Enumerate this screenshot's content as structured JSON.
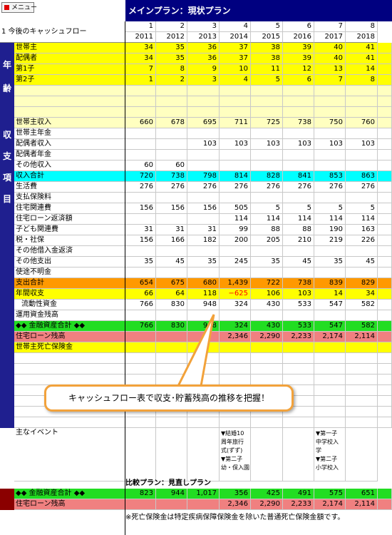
{
  "menu": {
    "label": "メニュー"
  },
  "title": "メインプラン：現状プラン",
  "header": {
    "section_label": "1 今後のキャッシュフロー",
    "indices": [
      "1",
      "2",
      "3",
      "4",
      "5",
      "6",
      "7",
      "8"
    ],
    "years": [
      "2011",
      "2012",
      "2013",
      "2014",
      "2015",
      "2016",
      "2017",
      "2018"
    ]
  },
  "side": {
    "age": [
      "年",
      "齢"
    ],
    "cf": [
      "収",
      "支",
      "項",
      "目"
    ]
  },
  "age_rows": [
    {
      "label": "世帯主",
      "values": [
        "34",
        "35",
        "36",
        "37",
        "38",
        "39",
        "40",
        "41"
      ]
    },
    {
      "label": "配偶者",
      "values": [
        "34",
        "35",
        "36",
        "37",
        "38",
        "39",
        "40",
        "41"
      ]
    },
    {
      "label": "第1子",
      "values": [
        "7",
        "8",
        "9",
        "10",
        "11",
        "12",
        "13",
        "14"
      ]
    },
    {
      "label": "第2子",
      "values": [
        "1",
        "2",
        "3",
        "4",
        "5",
        "6",
        "7",
        "8"
      ]
    }
  ],
  "cf_rows": [
    {
      "label": "世帯主収入",
      "values": [
        "660",
        "678",
        "695",
        "711",
        "725",
        "738",
        "750",
        "760"
      ]
    },
    {
      "label": "世帯主年金",
      "values": [
        "",
        "",
        "",
        "",
        "",
        "",
        "",
        ""
      ]
    },
    {
      "label": "配偶者収入",
      "values": [
        "",
        "",
        "103",
        "103",
        "103",
        "103",
        "103",
        "103"
      ]
    },
    {
      "label": "配偶者年金",
      "values": [
        "",
        "",
        "",
        "",
        "",
        "",
        "",
        ""
      ]
    },
    {
      "label": "その他収入",
      "values": [
        "60",
        "60",
        "",
        "",
        "",
        "",
        "",
        ""
      ]
    },
    {
      "label": "収入合計",
      "values": [
        "720",
        "738",
        "798",
        "814",
        "828",
        "841",
        "853",
        "863"
      ]
    },
    {
      "label": "生活費",
      "values": [
        "276",
        "276",
        "276",
        "276",
        "276",
        "276",
        "276",
        "276"
      ]
    },
    {
      "label": "支払保険料",
      "values": [
        "",
        "",
        "",
        "",
        "",
        "",
        "",
        ""
      ]
    },
    {
      "label": "住宅関連費",
      "values": [
        "156",
        "156",
        "156",
        "505",
        "5",
        "5",
        "5",
        "5"
      ]
    },
    {
      "label": "住宅ローン返済額",
      "values": [
        "",
        "",
        "",
        "114",
        "114",
        "114",
        "114",
        "114"
      ]
    },
    {
      "label": "子ども関連費",
      "values": [
        "31",
        "31",
        "31",
        "99",
        "88",
        "88",
        "190",
        "163"
      ]
    },
    {
      "label": "税・社保",
      "values": [
        "156",
        "166",
        "182",
        "200",
        "205",
        "210",
        "219",
        "226"
      ]
    },
    {
      "label": "その他借入金返済",
      "values": [
        "",
        "",
        "",
        "",
        "",
        "",
        "",
        ""
      ]
    },
    {
      "label": "その他支出",
      "values": [
        "35",
        "45",
        "35",
        "245",
        "35",
        "45",
        "35",
        "45"
      ]
    },
    {
      "label": "使途不明金",
      "values": [
        "",
        "",
        "",
        "",
        "",
        "",
        "",
        ""
      ]
    },
    {
      "label": "支出合計",
      "values": [
        "654",
        "675",
        "680",
        "1,439",
        "722",
        "738",
        "839",
        "829"
      ]
    },
    {
      "label": "年間収支",
      "values": [
        "66",
        "64",
        "118",
        "−625",
        "106",
        "103",
        "14",
        "34"
      ]
    },
    {
      "label": "流動性資金",
      "values": [
        "766",
        "830",
        "948",
        "324",
        "430",
        "533",
        "547",
        "582"
      ]
    },
    {
      "label": "運用資金残高",
      "values": [
        "",
        "",
        "",
        "",
        "",
        "",
        "",
        ""
      ]
    },
    {
      "label": "◆◆ 金融資産合計 ◆◆",
      "values": [
        "766",
        "830",
        "948",
        "324",
        "430",
        "533",
        "547",
        "582"
      ]
    },
    {
      "label": "住宅ローン残高",
      "values": [
        "",
        "",
        "",
        "2,346",
        "2,290",
        "2,233",
        "2,174",
        "2,114"
      ]
    },
    {
      "label": "世帯主死亡保険金",
      "values": [
        "",
        "",
        "",
        "",
        "",
        "",
        "",
        ""
      ]
    }
  ],
  "events": {
    "label": "主なイベント",
    "col4": [
      "▼結婚10",
      "周年旅行",
      "式(ずず)",
      "▼第二子",
      "幼・保入園"
    ],
    "col7": [
      "▼第一子",
      "中学校入",
      "学",
      "▼第二子",
      "小学校入"
    ]
  },
  "callout": "キャッシュフロー表で収支･貯蓄残高の推移を把握！",
  "compare": {
    "title": "比較プラン：見直しプラン",
    "rows": [
      {
        "label": "◆◆ 金融資産合計 ◆◆",
        "values": [
          "823",
          "944",
          "1,017",
          "356",
          "425",
          "491",
          "575",
          "651"
        ]
      },
      {
        "label": "住宅ローン残高",
        "values": [
          "",
          "",
          "",
          "2,346",
          "2,290",
          "2,233",
          "2,174",
          "2,114"
        ]
      }
    ],
    "note": "※死亡保険金は特定疾病保障保険金を除いた普通死亡保険金額です。"
  },
  "colors": {
    "navy": "#1f1f8f",
    "yellow": "#ffff00",
    "pale_yellow": "#ffffc0",
    "cyan": "#00ffff",
    "orange": "#ff9900",
    "green": "#22dd22",
    "pink": "#f08080",
    "callout_border": "#f2a23b",
    "negative": "#ff0000"
  }
}
